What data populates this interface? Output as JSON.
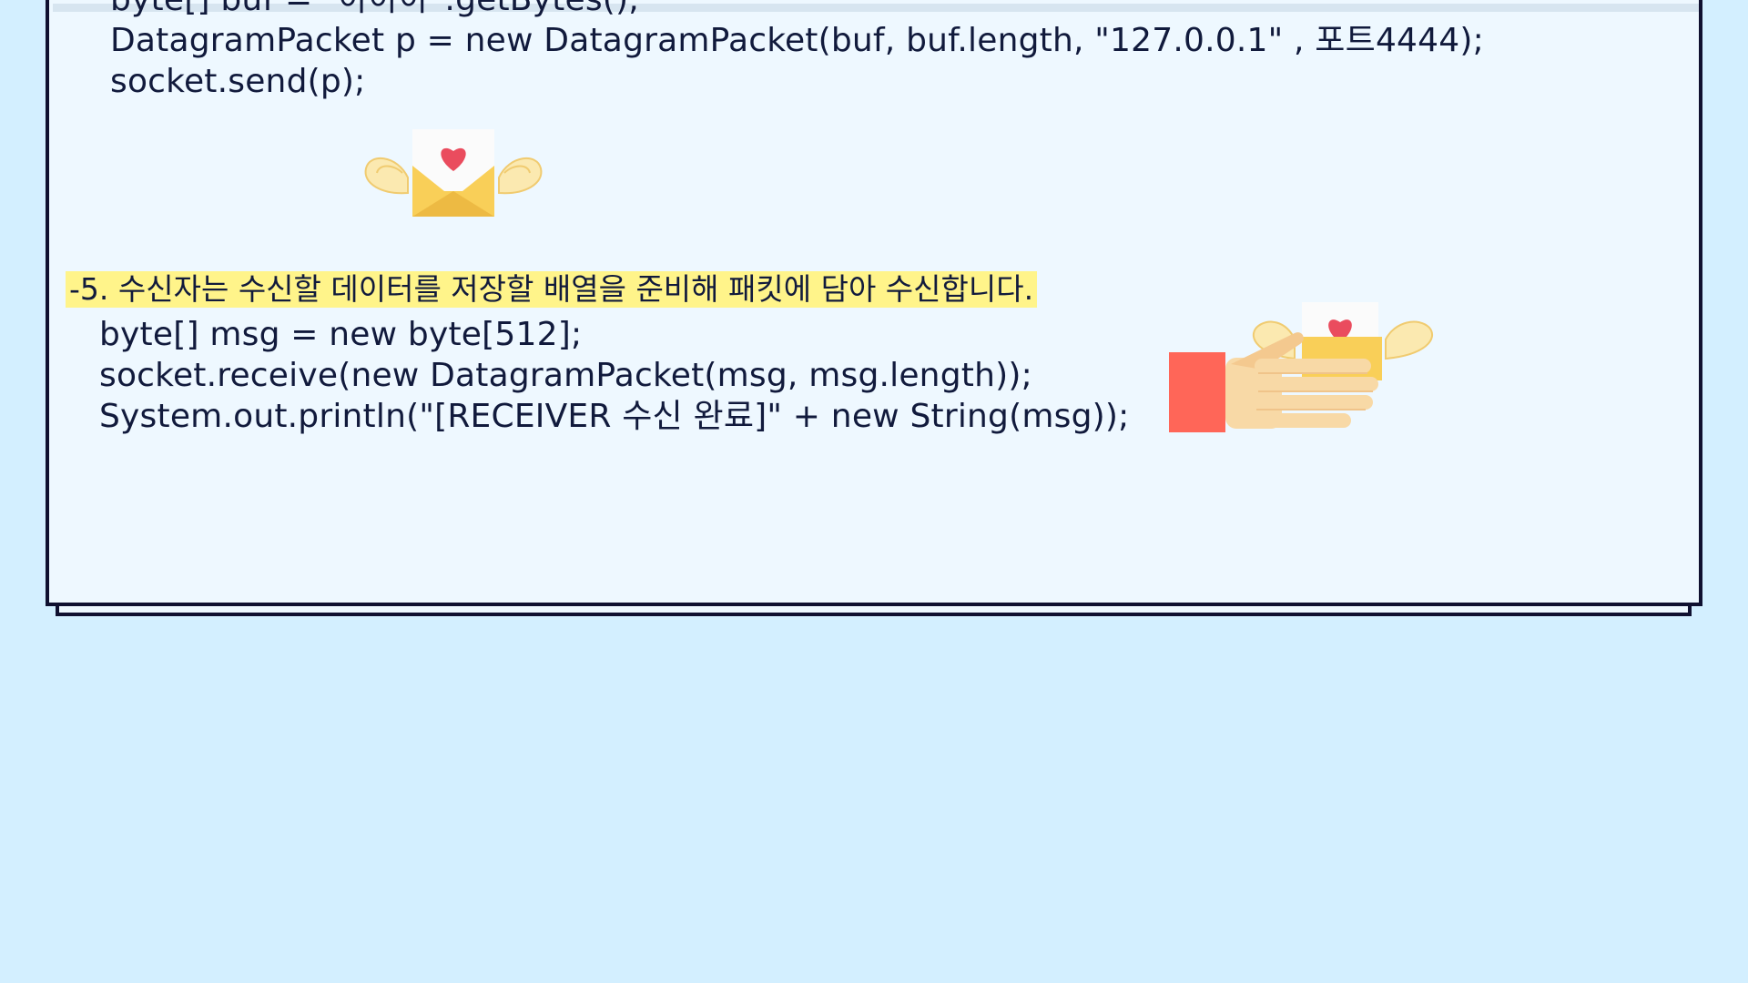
{
  "code_top": {
    "lines": [
      "byte[] buf = \"아아아\".getBytes();",
      "DatagramPacket p = new DatagramPacket(buf, buf.length, \"127.0.0.1\" , 포트4444);",
      "socket.send(p);"
    ]
  },
  "step5": {
    "heading": "-5. 수신자는 수신할 데이터를 저장할 배열을 준비해 패킷에 담아 수신합니다."
  },
  "code_bottom": {
    "lines": [
      "byte[] msg = new byte[512];",
      "socket.receive(new DatagramPacket(msg, msg.length));",
      "System.out.println(\"[RECEIVER 수신 완료]\" + new String(msg));"
    ]
  },
  "colors": {
    "page_background": "#d3efff",
    "card_background": "#eef8ff",
    "border": "#0f1030",
    "highlight": "#fff48a",
    "text": "#111a3c",
    "heart": "#ea4c5e",
    "envelope": "#f9cf58",
    "sleeve": "#ff6658",
    "hand": "#f8d9a6"
  },
  "icons": {
    "top": "winged-love-letter-icon",
    "bottom": "hand-holding-winged-love-letter-icon"
  }
}
